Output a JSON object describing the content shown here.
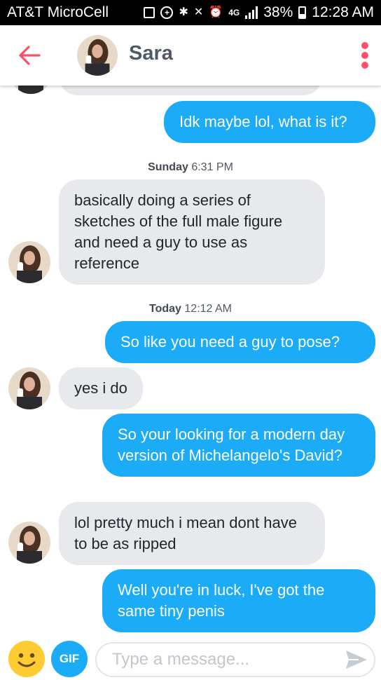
{
  "status_bar": {
    "carrier": "AT&T MicroCell",
    "network": "4G",
    "battery_percent": "38%",
    "time": "12:28 AM"
  },
  "header": {
    "name": "Sara"
  },
  "conversation": {
    "messages": [
      {
        "side": "out",
        "text": "Idk maybe lol, what is it?"
      },
      {
        "side": "stamp",
        "day": "Sunday",
        "time": "6:31 PM"
      },
      {
        "side": "in",
        "text": "basically doing a series of sketches of the full male figure and need a guy to use as reference"
      },
      {
        "side": "stamp",
        "day": "Today",
        "time": "12:12 AM"
      },
      {
        "side": "out",
        "text": "So like you need a guy to pose?"
      },
      {
        "side": "in",
        "text": "yes i do"
      },
      {
        "side": "out",
        "text": "So your looking for a modern day version of Michelangelo's David?"
      },
      {
        "side": "in",
        "text": "lol pretty much i mean dont have to be as ripped"
      },
      {
        "side": "out",
        "text": "Well you're in luck, I've got the same tiny penis"
      }
    ]
  },
  "composer": {
    "gif_label": "GIF",
    "placeholder": "Type a message..."
  },
  "colors": {
    "accent": "#fd5068",
    "outgoing_bubble": "#1cabf7",
    "incoming_bubble": "#e8e9ed",
    "emoji": "#ffcc33"
  },
  "icons": [
    "back-arrow-icon",
    "menu-kebab-icon",
    "emoji-icon",
    "send-icon"
  ]
}
